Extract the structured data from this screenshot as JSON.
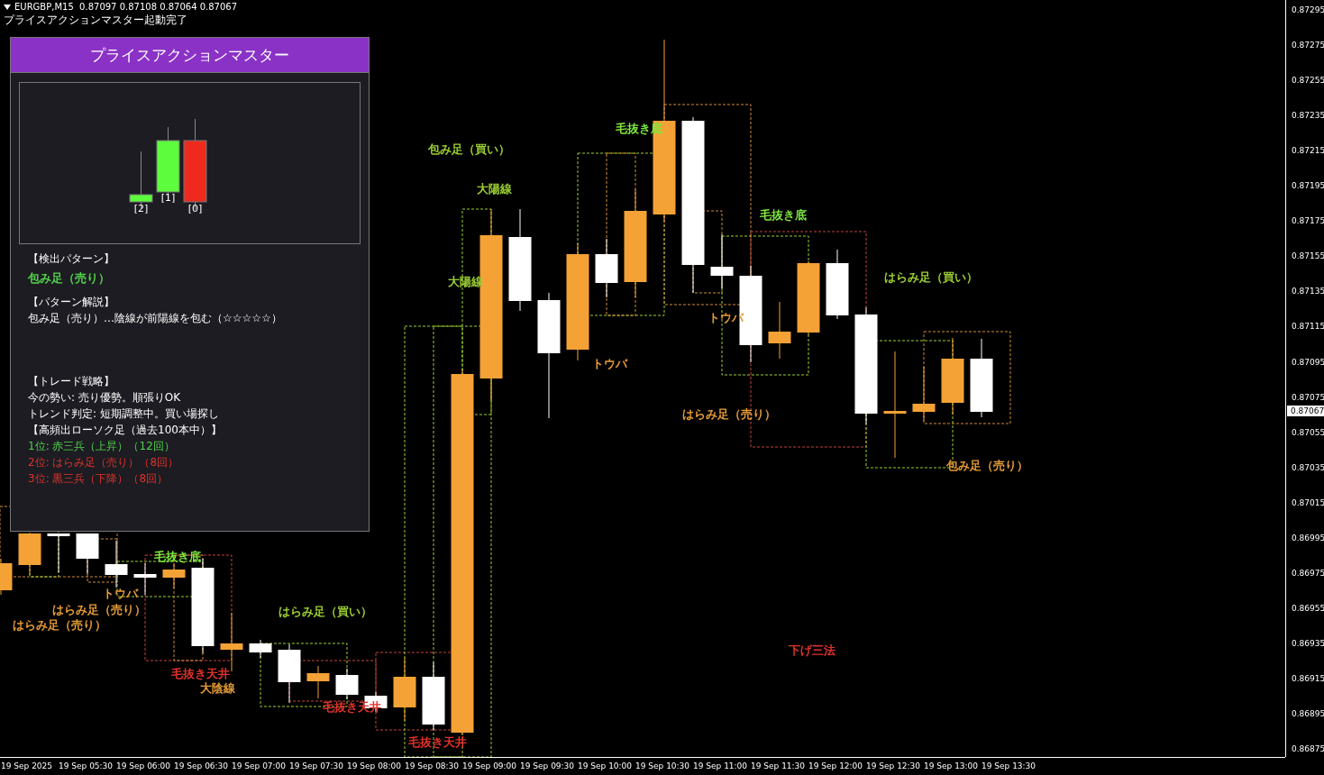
{
  "chart_header": {
    "symbol_line": "EURGBP,M15  0.87097 0.87108 0.87064 0.87067",
    "status": "プライスアクションマスター起動完了"
  },
  "panel": {
    "title": "プライスアクションマスター",
    "mini_candles": [
      {
        "label": "[2]",
        "color": "#5dfc3c"
      },
      {
        "label": "[1]",
        "color": "#5dfc3c"
      },
      {
        "label": "[0]",
        "color": "#ee2a1f"
      }
    ],
    "pattern_heading": "【検出パターン】",
    "pattern": {
      "text": "包み足（売り）",
      "color": "#52d04a"
    },
    "explanation_heading": "【パターン解説】",
    "explanation": "包み足（売り）…陰線が前陽線を包む（☆☆☆☆☆）",
    "strategy_heading": "【トレード戦略】",
    "strategy_lines": [
      "今の勢い: 売り優勢。順張りOK",
      "トレンド判定: 短期調整中。買い場探し"
    ],
    "frequent_heading": "【高頻出ローソク足（過去100本中）】",
    "frequent": [
      {
        "text": "1位: 赤三兵（上昇）（12回）",
        "color": "#52d04a"
      },
      {
        "text": "2位: はらみ足（売り）（8回）",
        "color": "#e0322a"
      },
      {
        "text": "3位: 黒三兵（下降）（8回）",
        "color": "#e0322a"
      }
    ]
  },
  "pattern_labels": [
    {
      "text": "包み足（買い）",
      "color": "#9acd32"
    },
    {
      "text": "大陽線",
      "color": "#9acd32"
    },
    {
      "text": "大陽線",
      "color": "#9acd32"
    },
    {
      "text": "毛抜き底",
      "color": "#7ee83f"
    },
    {
      "text": "毛抜き底",
      "color": "#7ee83f"
    },
    {
      "text": "トウバ",
      "color": "#e39a36"
    },
    {
      "text": "トウバ",
      "color": "#e39a36"
    },
    {
      "text": "はらみ足（売り）",
      "color": "#e39a36"
    },
    {
      "text": "はらみ足（買い）",
      "color": "#9acd32"
    },
    {
      "text": "包み足（売り）",
      "color": "#e39a36"
    },
    {
      "text": "下げ三法",
      "color": "#e0322a"
    },
    {
      "text": "はらみ足（買い）",
      "color": "#9acd32"
    },
    {
      "text": "毛抜き底",
      "color": "#7ee83f"
    },
    {
      "text": "トウバ",
      "color": "#e39a36"
    },
    {
      "text": "はらみ足（売り）",
      "color": "#e39a36"
    },
    {
      "text": "はらみ足（売り）",
      "color": "#e39a36"
    },
    {
      "text": "毛抜き天井",
      "color": "#e0322a"
    },
    {
      "text": "毛抜き天井",
      "color": "#e0322a"
    },
    {
      "text": "毛抜き天井",
      "color": "#e0322a"
    },
    {
      "text": "大陰線",
      "color": "#e39a36"
    }
  ],
  "price_axis": [
    "0.87295",
    "0.87275",
    "0.87255",
    "0.87235",
    "0.87215",
    "0.87195",
    "0.87175",
    "0.87155",
    "0.87135",
    "0.87115",
    "0.87095",
    "0.87075",
    "0.87055",
    "0.87035",
    "0.87015",
    "0.86995",
    "0.86975",
    "0.86955",
    "0.86935",
    "0.86915",
    "0.86895",
    "0.86875"
  ],
  "current_price": "0.87067",
  "time_axis": [
    "19 Sep 2025",
    "19 Sep 05:30",
    "19 Sep 06:00",
    "19 Sep 06:30",
    "19 Sep 07:00",
    "19 Sep 07:30",
    "19 Sep 08:00",
    "19 Sep 08:30",
    "19 Sep 09:00",
    "19 Sep 09:30",
    "19 Sep 10:00",
    "19 Sep 10:30",
    "19 Sep 11:00",
    "19 Sep 11:30",
    "19 Sep 12:00",
    "19 Sep 12:30",
    "19 Sep 13:00",
    "19 Sep 13:30"
  ]
}
